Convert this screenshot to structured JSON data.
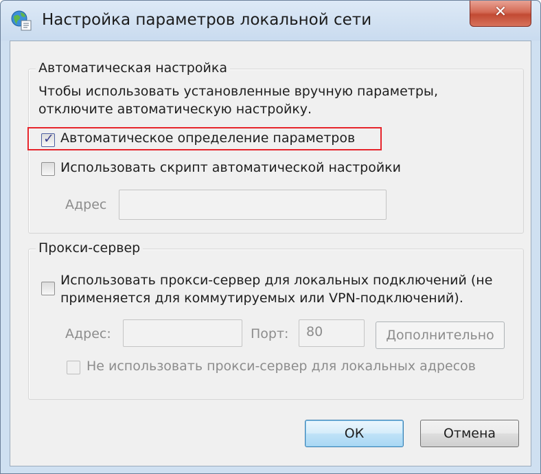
{
  "window": {
    "title": "Настройка параметров локальной сети",
    "close_label": "✕"
  },
  "auto_config": {
    "legend": "Автоматическая настройка",
    "note_line1": "Чтобы использовать установленные вручную параметры,",
    "note_line2": "отключите автоматическую настройку.",
    "auto_detect": {
      "label": "Автоматическое определение параметров",
      "checked": true
    },
    "use_script": {
      "label": "Использовать скрипт автоматической настройки",
      "checked": false
    },
    "address_label": "Адрес",
    "address_value": ""
  },
  "proxy": {
    "legend": "Прокси-сервер",
    "use_proxy_line1": "Использовать прокси-сервер для локальных подключений (не",
    "use_proxy_line2": "применяется для коммутируемых или VPN-подключений).",
    "use_proxy_checked": false,
    "address_label": "Адрес:",
    "address_value": "",
    "port_label": "Порт:",
    "port_value": "80",
    "advanced_button": "Дополнительно",
    "bypass_local": {
      "label": "Не использовать прокси-сервер для локальных адресов",
      "checked": false
    }
  },
  "buttons": {
    "ok": "ОК",
    "cancel": "Отмена"
  },
  "colors": {
    "highlight": "#e6232a",
    "check": "#3a3e8c"
  }
}
